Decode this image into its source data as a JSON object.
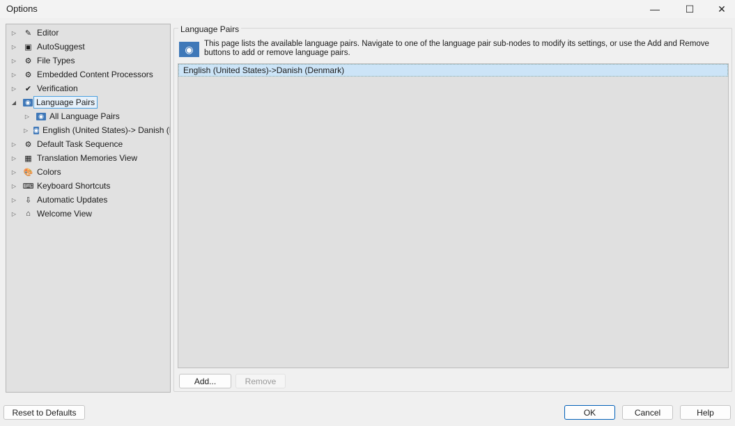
{
  "window": {
    "title": "Options",
    "minimize": "—",
    "maximize": "☐",
    "close": "✕"
  },
  "tree": [
    {
      "label": "Editor",
      "icon": "pencil-icon",
      "glyph": "✎",
      "level": 0,
      "expanded": false
    },
    {
      "label": "AutoSuggest",
      "icon": "autosuggest-icon",
      "glyph": "▣",
      "level": 0,
      "expanded": false
    },
    {
      "label": "File Types",
      "icon": "file-gear-icon",
      "glyph": "⚙",
      "level": 0,
      "expanded": false
    },
    {
      "label": "Embedded Content Processors",
      "icon": "file-gear-icon",
      "glyph": "⚙",
      "level": 0,
      "expanded": false
    },
    {
      "label": "Verification",
      "icon": "verification-icon",
      "glyph": "✔",
      "level": 0,
      "expanded": false
    },
    {
      "label": "Language Pairs",
      "icon": "globe-icon",
      "glyph": "◉",
      "level": 0,
      "expanded": true,
      "selected": true
    },
    {
      "label": "All Language Pairs",
      "icon": "globe-icon",
      "glyph": "◉",
      "level": 1,
      "expanded": false
    },
    {
      "label": "English (United States)-> Danish (Denmark)",
      "icon": "globe-icon",
      "glyph": "◉",
      "level": 1,
      "expanded": false
    },
    {
      "label": "Default Task Sequence",
      "icon": "task-gear-icon",
      "glyph": "⚙",
      "level": 0,
      "expanded": false
    },
    {
      "label": "Translation Memories View",
      "icon": "tm-icon",
      "glyph": "▦",
      "level": 0,
      "expanded": false
    },
    {
      "label": "Colors",
      "icon": "palette-icon",
      "glyph": "🎨",
      "level": 0,
      "expanded": false
    },
    {
      "label": "Keyboard Shortcuts",
      "icon": "keyboard-icon",
      "glyph": "⌨",
      "level": 0,
      "expanded": false
    },
    {
      "label": "Automatic Updates",
      "icon": "update-icon",
      "glyph": "⇩",
      "level": 0,
      "expanded": false
    },
    {
      "label": "Welcome View",
      "icon": "home-icon",
      "glyph": "⌂",
      "level": 0,
      "expanded": false
    }
  ],
  "page": {
    "group_title": "Language Pairs",
    "description": "This page lists the available language pairs. Navigate to one of the language pair sub-nodes to modify its settings, or use the Add and Remove buttons to add or remove language pairs.",
    "pairs": [
      "English (United States)->Danish (Denmark)"
    ],
    "add": "Add...",
    "remove": "Remove"
  },
  "footer": {
    "reset": "Reset to Defaults",
    "ok": "OK",
    "cancel": "Cancel",
    "help": "Help"
  }
}
